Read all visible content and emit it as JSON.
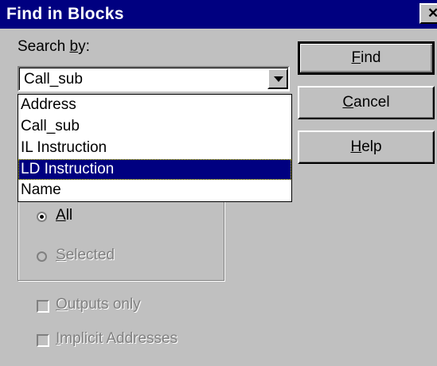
{
  "window": {
    "title": "Find in Blocks",
    "close_glyph": "✕"
  },
  "search_by": {
    "label_pre": "Search ",
    "label_key": "b",
    "label_post": "y:",
    "selected": "Call_sub",
    "options": [
      "Address",
      "Call_sub",
      "IL Instruction",
      "LD Instruction",
      "Name"
    ],
    "highlighted": "LD Instruction"
  },
  "buttons": {
    "find": {
      "key": "F",
      "rest": "ind"
    },
    "cancel": {
      "key": "C",
      "rest": "ancel"
    },
    "help": {
      "key": "H",
      "rest": "elp"
    }
  },
  "scope": {
    "all": {
      "key": "A",
      "rest": "ll",
      "checked": true
    },
    "selected": {
      "key": "S",
      "rest": "elected",
      "checked": false
    }
  },
  "options": {
    "outputs_only": {
      "key": "O",
      "rest": "utputs only",
      "checked": false
    },
    "implicit_addresses": {
      "key": "I",
      "rest": "mplicit Addresses",
      "checked": false
    }
  }
}
